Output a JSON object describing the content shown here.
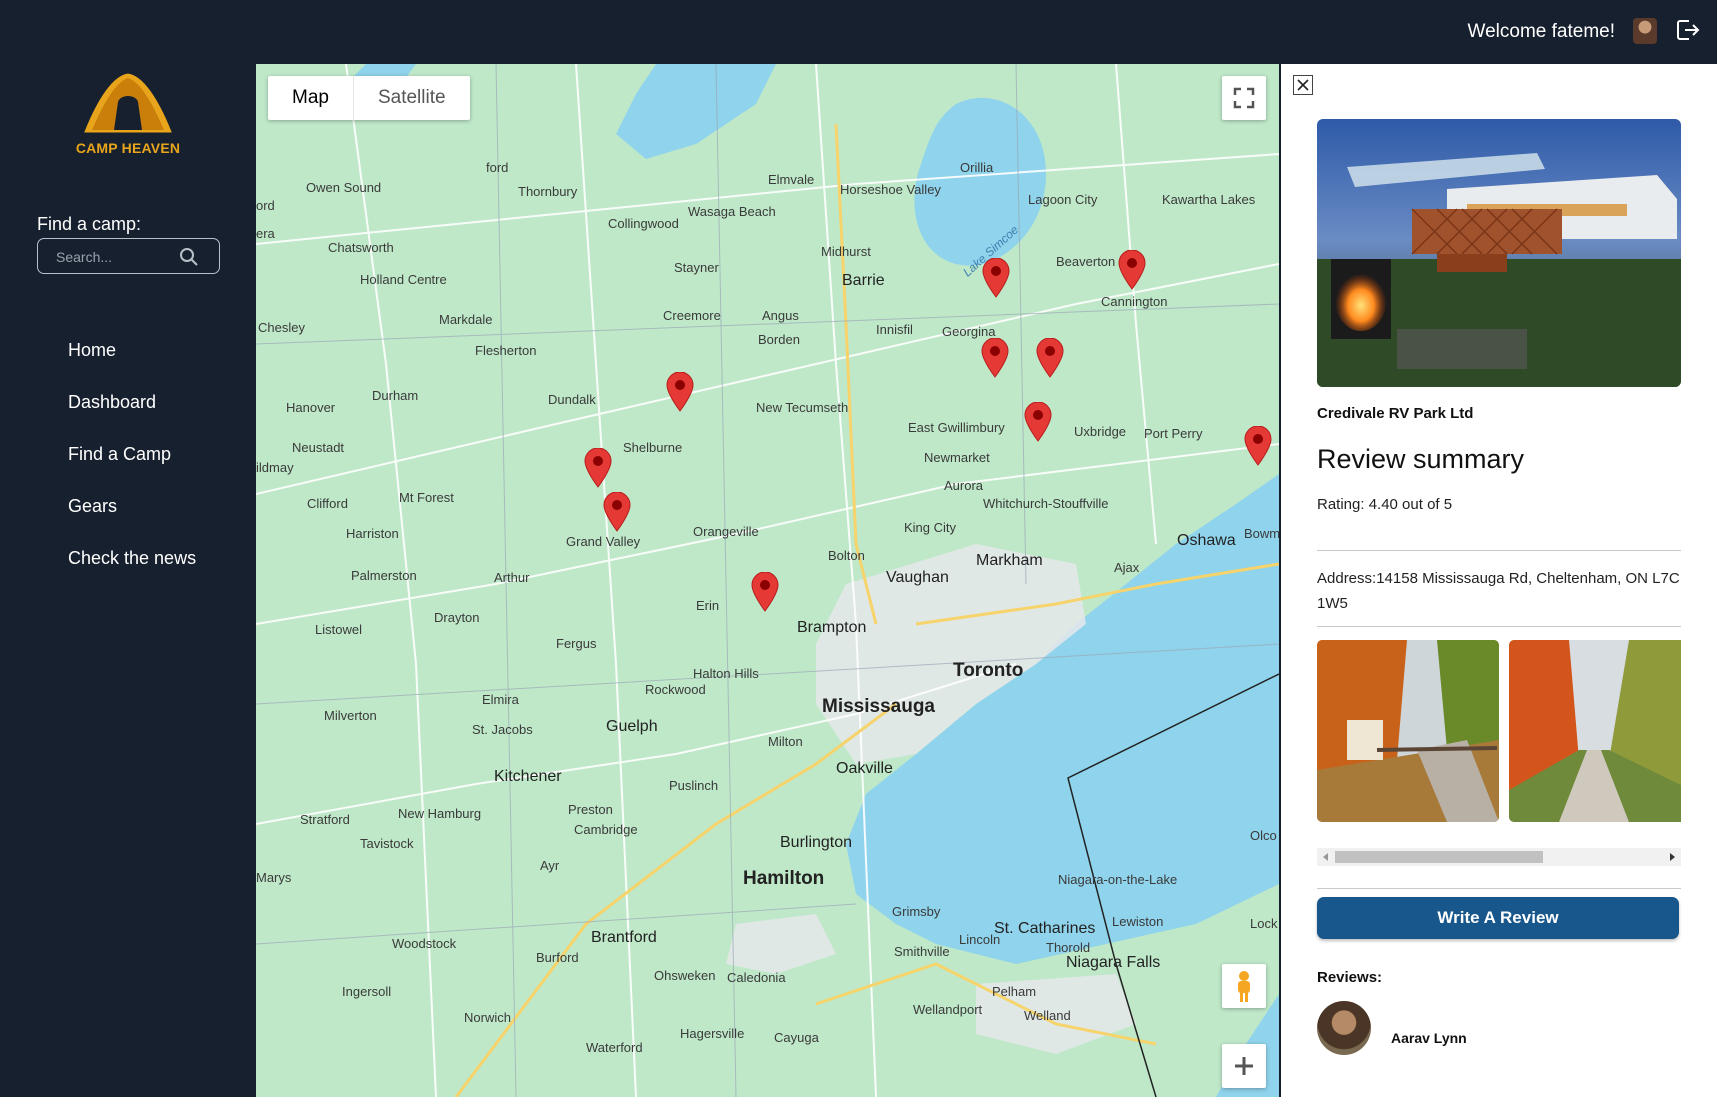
{
  "header": {
    "welcome_text": "Welcome fateme!",
    "avatar_icon": "user-avatar",
    "logout_icon": "logout-icon"
  },
  "sidebar": {
    "logo_text": "CAMP HEAVEN",
    "find_label": "Find a camp:",
    "search_placeholder": "Search...",
    "nav": [
      {
        "label": "Home"
      },
      {
        "label": "Dashboard"
      },
      {
        "label": "Find a Camp"
      },
      {
        "label": "Gears"
      },
      {
        "label": "Check the news"
      }
    ]
  },
  "map": {
    "type_options": [
      "Map",
      "Satellite"
    ],
    "selected_type": "Map",
    "places": {
      "toronto": "Toronto",
      "mississauga": "Mississauga",
      "hamilton": "Hamilton",
      "brampton": "Brampton",
      "vaughan": "Vaughan",
      "markham": "Markham",
      "oshawa": "Oshawa",
      "oakville": "Oakville",
      "burlington": "Burlington",
      "guelph": "Guelph",
      "kitchener": "Kitchener",
      "cambridge": "Cambridge",
      "barrie": "Barrie",
      "orangeville": "Orangeville",
      "shelburne": "Shelburne",
      "brantford": "Brantford",
      "st_catharines": "St. Catharines",
      "niagara_falls": "Niagara Falls",
      "milton": "Milton",
      "newmarket": "Newmarket",
      "aurora": "Aurora",
      "orillia": "Orillia",
      "collingwood": "Collingwood",
      "owen_sound": "Owen Sound",
      "lake_simcoe": "Lake Simcoe",
      "innisfil": "Innisfil",
      "uxbridge": "Uxbridge",
      "beaverton": "Beaverton",
      "lagoon_city": "Lagoon City",
      "grand_valley": "Grand Valley",
      "erin": "Erin",
      "fergus": "Fergus",
      "halton_hills": "Halton Hills",
      "bolton": "Bolton",
      "king_city": "King City",
      "dundalk": "Dundalk",
      "durham": "Durham",
      "hanover": "Hanover",
      "markdale": "Markdale",
      "flesherton": "Flesherton",
      "creemore": "Creemore",
      "stayner": "Stayner",
      "wasaga_beach": "Wasaga Beach",
      "thornbury": "Thornbury",
      "woodstock": "Woodstock",
      "stratford": "Stratford",
      "ajax": "Ajax",
      "pickering": "Whitchurch-Stouffville",
      "grimsby": "Grimsby",
      "welland": "Welland",
      "new_tecumseth": "New Tecumseth",
      "port_perry": "Port Perry",
      "guelph_rockwood": "Rockwood",
      "elmira": "Elmira",
      "arthur": "Arthur",
      "harriston": "Harriston",
      "listowel": "Listowel",
      "drayton": "Drayton",
      "palmerston": "Palmerston",
      "mount_forest": "Mt Forest",
      "clifford": "Clifford",
      "neustadt": "Neustadt",
      "chesley": "Chesley",
      "holland_centre": "Holland Centre",
      "chatsworth": "Chatsworth",
      "angus": "Angus",
      "borden": "Borden",
      "midhurst": "Midhurst",
      "elmvale": "Elmvale",
      "horseshoe_valley": "Horseshoe Valley",
      "kawartha_lakes": "Kawartha Lakes",
      "georgina": "Georgina",
      "east_gwillimbury": "East Gwillimbury",
      "cannington": "Cannington",
      "bowmanville": "Bowm",
      "milverton": "Milverton",
      "st_jacobs": "St. Jacobs",
      "new_hamburg": "New Hamburg",
      "tavistock": "Tavistock",
      "preston": "Preston",
      "puslinch": "Puslinch",
      "ayr": "Ayr",
      "burford": "Burford",
      "ohsweken": "Ohsweken",
      "caledonia": "Caledonia",
      "hagersville": "Hagersville",
      "cayuga": "Cayuga",
      "waterford": "Waterford",
      "norwich": "Norwich",
      "ingersoll": "Ingersoll",
      "smithville": "Smithville",
      "lincoln": "Lincoln",
      "pelham": "Pelham",
      "wellandport": "Wellandport",
      "thorold": "Thorold",
      "lewiston": "Lewiston",
      "niagara_on_the_lake": "Niagara-on-the-Lake",
      "olcott": "Olco",
      "lockport": "Lock",
      "marys": "Marys",
      "mildmay": "ildmay",
      "ford": "ford",
      "ord": "ord",
      "era": "era"
    }
  },
  "camp": {
    "name": "Credivale RV Park Ltd",
    "summary_title": "Review summary",
    "rating_text": "Rating: 4.40 out of 5",
    "address_text": "Address:14158 Mississauga Rd, Cheltenham, ON L7C 1W5",
    "write_review_label": "Write A Review",
    "reviews_label": "Reviews:",
    "reviews": [
      {
        "name": "Aarav Lynn"
      }
    ]
  },
  "colors": {
    "sidebar_bg": "#17202e",
    "accent": "#17578c",
    "logo": "#e8a51c",
    "pin": "#e53935",
    "water": "#8fd3ec"
  }
}
